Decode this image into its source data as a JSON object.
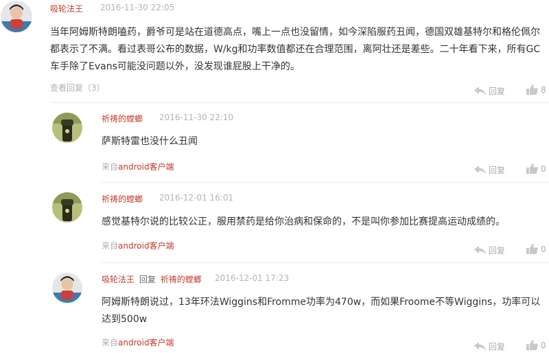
{
  "colors": {
    "username": "#c0392b",
    "meta": "#b4b4b4",
    "text": "#333333",
    "divider": "#e9e9e9",
    "icon": "#c8c8c8"
  },
  "comment": {
    "username": "吸轮法王",
    "time": "2016-11-30 22:05",
    "text": "当年阿姆斯特朗嗑药，爵爷可是站在道德高点，嘴上一点也没留情，如今深陷服药丑闻，德国双雄基特尔和格伦佩尔都表示了不满。看过表哥公布的数据，W/kg和功率数值都还在合理范围，离阿壮还是差些。二十年看下来，所有GC车手除了Evans可能没问题以外，没发现谁屁股上干净的。",
    "view_replies": "查看回复（3）",
    "reply_label": "回复",
    "like_count": "8",
    "icons": {
      "reply": "reply-arrow-icon",
      "like": "thumbs-up-icon"
    }
  },
  "replies": [
    {
      "username": "祈祷的螳螂",
      "time": "2016-11-30 22:10",
      "text": "萨斯特雷也没什么丑闻",
      "source_prefix": "来自",
      "source_app": "android客户端",
      "reply_label": "回复",
      "like_count": "0"
    },
    {
      "username": "祈祷的螳螂",
      "time": "2016-12-01 16:01",
      "text": "感觉基特尔说的比较公正，服用禁药是给你治病和保命的，不是叫你参加比赛提高运动成绩的。",
      "source_prefix": "来自",
      "source_app": "android客户端",
      "reply_label": "回复",
      "like_count": "0"
    },
    {
      "username": "吸轮法王",
      "reply_word": "回复",
      "reply_to": "祈祷的螳螂",
      "time": "2016-12-01 17:23",
      "text": "阿姆斯特朗说过，13年环法Wiggins和Fromme功率为470w，而如果Froome不等Wiggins，功率可以达到500w",
      "source_prefix": "来自",
      "source_app": "android客户端",
      "reply_label": "回复",
      "like_count": "0"
    }
  ]
}
